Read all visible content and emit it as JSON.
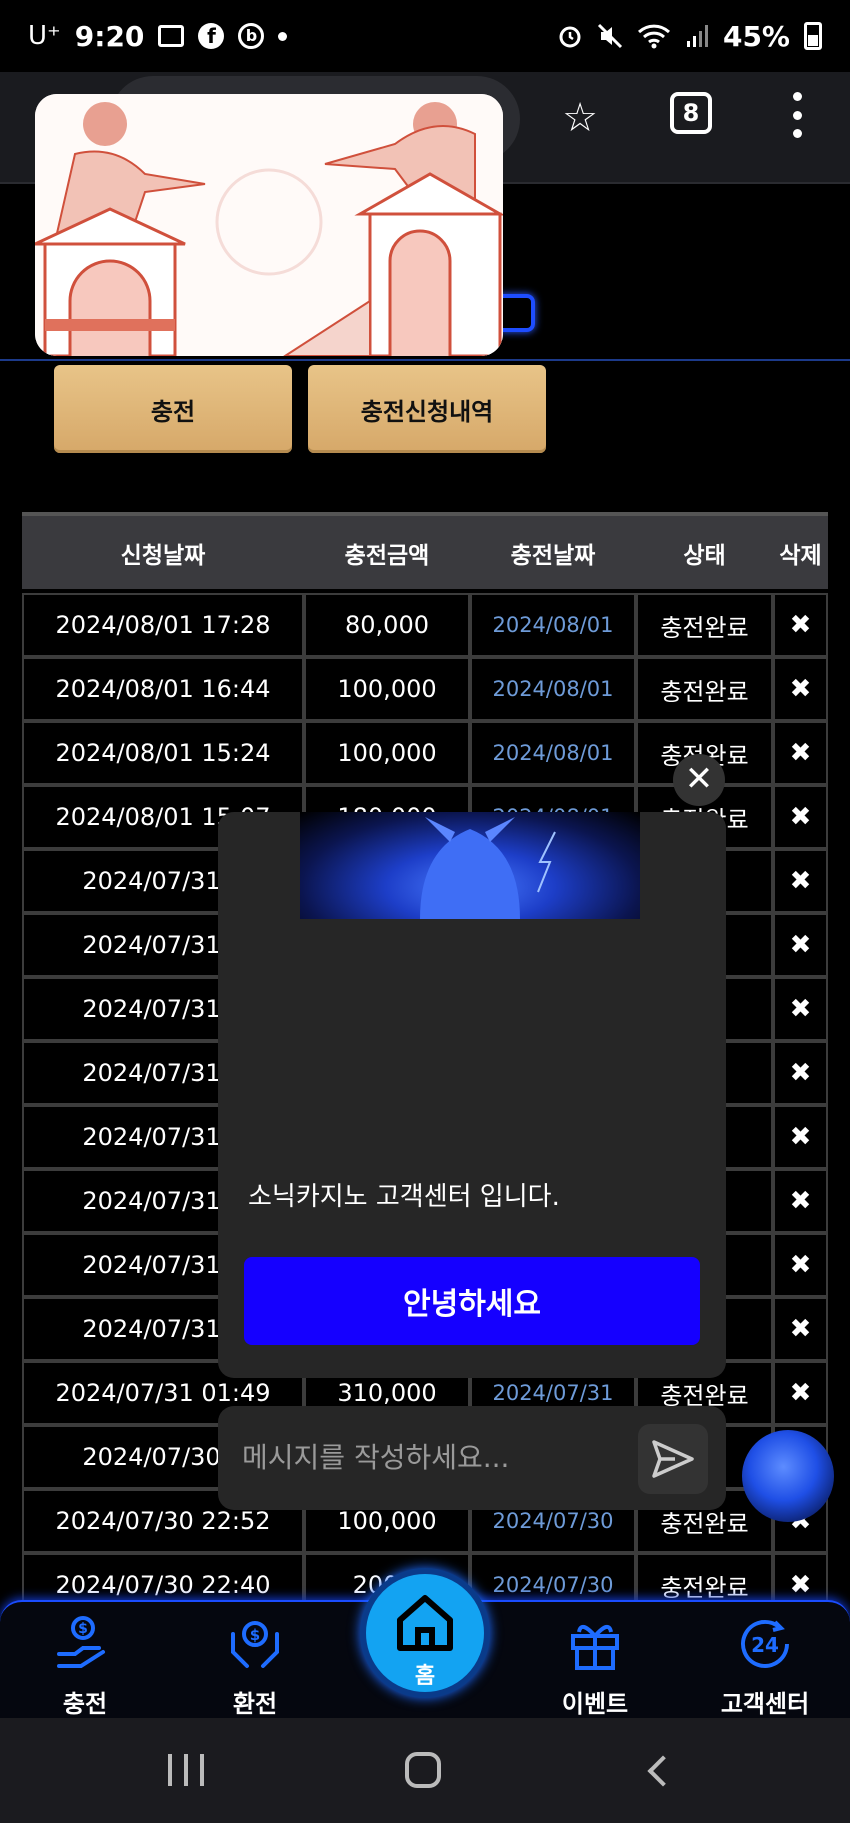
{
  "status_bar": {
    "carrier": "U⁺",
    "time": "9:20",
    "battery": "45%"
  },
  "browser": {
    "tab_count": "8"
  },
  "buttons": {
    "charge": "충전",
    "charge_history": "충전신청내역"
  },
  "table": {
    "headers": [
      "신청날짜",
      "충전금액",
      "충전날짜",
      "상태",
      "삭제"
    ],
    "rows": [
      {
        "request_date": "2024/08/01 17:28",
        "amount": "80,000",
        "charge_date": "2024/08/01",
        "status": "충전완료",
        "delete": "✖"
      },
      {
        "request_date": "2024/08/01 16:44",
        "amount": "100,000",
        "charge_date": "2024/08/01",
        "status": "충전완료",
        "delete": "✖"
      },
      {
        "request_date": "2024/08/01 15:24",
        "amount": "100,000",
        "charge_date": "2024/08/01",
        "status": "충전완료",
        "delete": "✖"
      },
      {
        "request_date": "2024/08/01 15:07",
        "amount": "180,000",
        "charge_date": "2024/08/01",
        "status": "충전완료",
        "delete": "✖"
      },
      {
        "request_date": "2024/07/31 1",
        "amount": "",
        "charge_date": "",
        "status": "료",
        "delete": "✖"
      },
      {
        "request_date": "2024/07/31 1",
        "amount": "",
        "charge_date": "",
        "status": "료",
        "delete": "✖"
      },
      {
        "request_date": "2024/07/31 1",
        "amount": "",
        "charge_date": "",
        "status": "료",
        "delete": "✖"
      },
      {
        "request_date": "2024/07/31 1",
        "amount": "",
        "charge_date": "",
        "status": "료",
        "delete": "✖"
      },
      {
        "request_date": "2024/07/31 1",
        "amount": "",
        "charge_date": "",
        "status": "료",
        "delete": "✖"
      },
      {
        "request_date": "2024/07/31 1",
        "amount": "",
        "charge_date": "",
        "status": "료",
        "delete": "✖"
      },
      {
        "request_date": "2024/07/31 1",
        "amount": "",
        "charge_date": "",
        "status": "료",
        "delete": "✖"
      },
      {
        "request_date": "2024/07/31 0",
        "amount": "",
        "charge_date": "",
        "status": "료",
        "delete": "✖"
      },
      {
        "request_date": "2024/07/31 01:49",
        "amount": "310,000",
        "charge_date": "2024/07/31",
        "status": "충전완료",
        "delete": "✖"
      },
      {
        "request_date": "2024/07/30 2",
        "amount": "",
        "charge_date": "",
        "status": "료",
        "delete": "✖"
      },
      {
        "request_date": "2024/07/30 22:52",
        "amount": "100,000",
        "charge_date": "2024/07/30",
        "status": "충전완료",
        "delete": "✖"
      },
      {
        "request_date": "2024/07/30 22:40",
        "amount": "200,0",
        "charge_date": "2024/07/30",
        "status": "충전완료",
        "delete": "✖"
      }
    ]
  },
  "chat": {
    "close": "✕",
    "message": "소닉카지노 고객센터 입니다.",
    "greeting_button": "안녕하세요",
    "input_placeholder": "메시지를 작성하세요..."
  },
  "bottom_nav": {
    "items": [
      {
        "label": "충전",
        "icon": "deposit-icon"
      },
      {
        "label": "환전",
        "icon": "exchange-icon"
      },
      {
        "label": "홈",
        "icon": "home-icon"
      },
      {
        "label": "이벤트",
        "icon": "gift-icon"
      },
      {
        "label": "고객센터",
        "icon": "support-24-icon"
      }
    ]
  },
  "colors": {
    "accent_gold": "#d6a869",
    "chat_button": "#1500ff",
    "nav_glow": "#1a4cff",
    "home_circle": "#13a3f2",
    "date_link": "#6e9bd8"
  }
}
